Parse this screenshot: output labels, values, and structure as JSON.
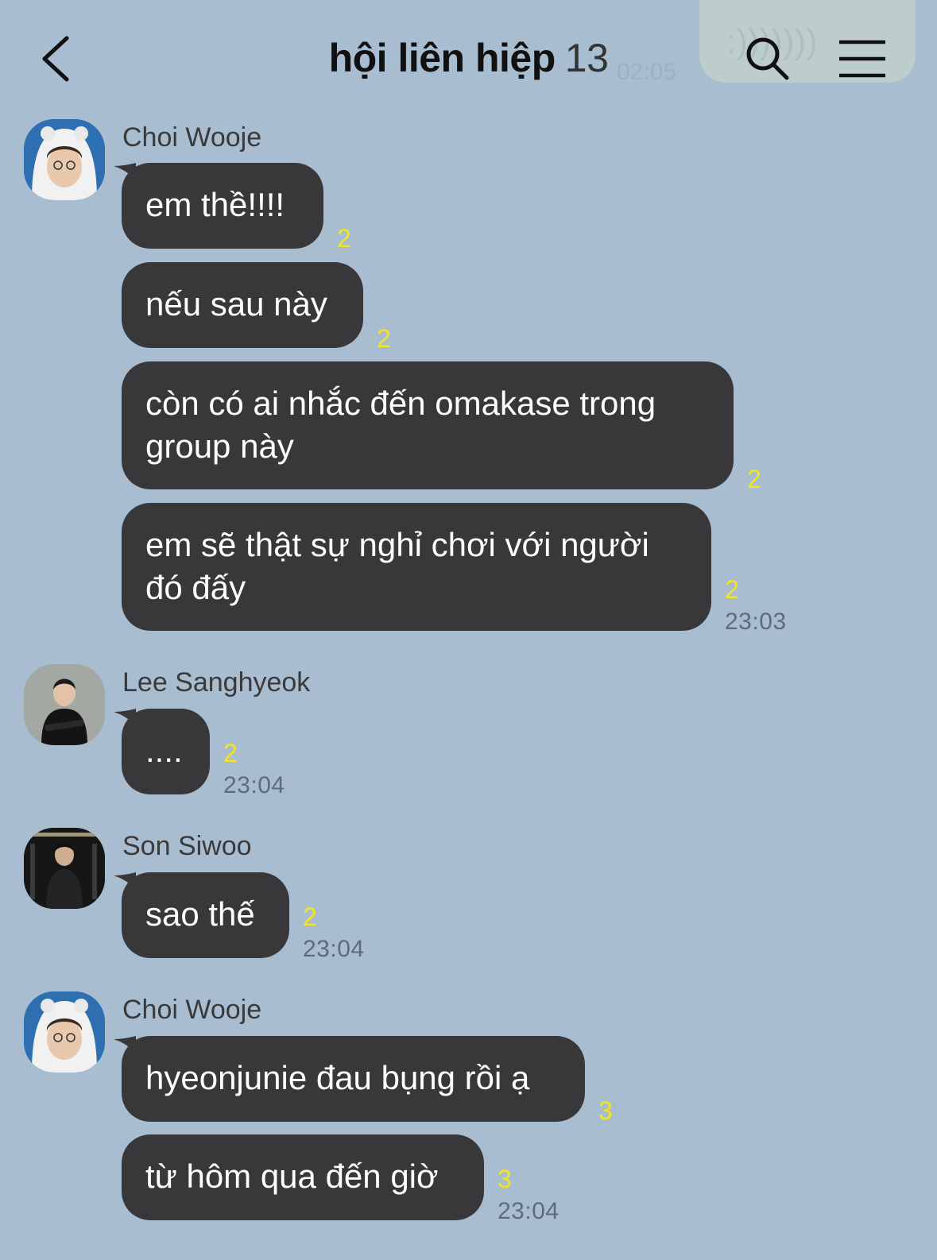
{
  "header": {
    "title": "hội liên hiệp",
    "member_count": "13",
    "back_icon": "chevron-left-icon",
    "search_icon": "search-icon",
    "menu_icon": "hamburger-menu-icon"
  },
  "background_overlay": {
    "text": ":)))))))",
    "time": "02:05"
  },
  "messages": [
    {
      "sender": "Choi Wooje",
      "avatar_icon": "avatar-choi-wooje",
      "text": "em thề!!!!",
      "unread": "2"
    },
    {
      "text": "nếu sau này",
      "unread": "2"
    },
    {
      "text": "còn có ai nhắc đến omakase trong group này",
      "unread": "2"
    },
    {
      "text": "em sẽ thật sự nghỉ chơi với người đó đấy",
      "unread": "2",
      "time": "23:03"
    },
    {
      "sender": "Lee Sanghyeok",
      "avatar_icon": "avatar-lee-sanghyeok",
      "text": "....",
      "unread": "2",
      "time": "23:04"
    },
    {
      "sender": "Son Siwoo",
      "avatar_icon": "avatar-son-siwoo",
      "text": "sao thế",
      "unread": "2",
      "time": "23:04"
    },
    {
      "sender": "Choi Wooje",
      "avatar_icon": "avatar-choi-wooje",
      "text": "hyeonjunie đau bụng rồi ạ",
      "unread": "3"
    },
    {
      "text": "từ hôm qua đến giờ",
      "unread": "3",
      "time": "23:04"
    }
  ],
  "colors": {
    "background": "#a9bdd1",
    "bubble": "#38383b",
    "bubble_text": "#ffffff",
    "unread": "#f5e51e",
    "time": "#5f6b77"
  }
}
